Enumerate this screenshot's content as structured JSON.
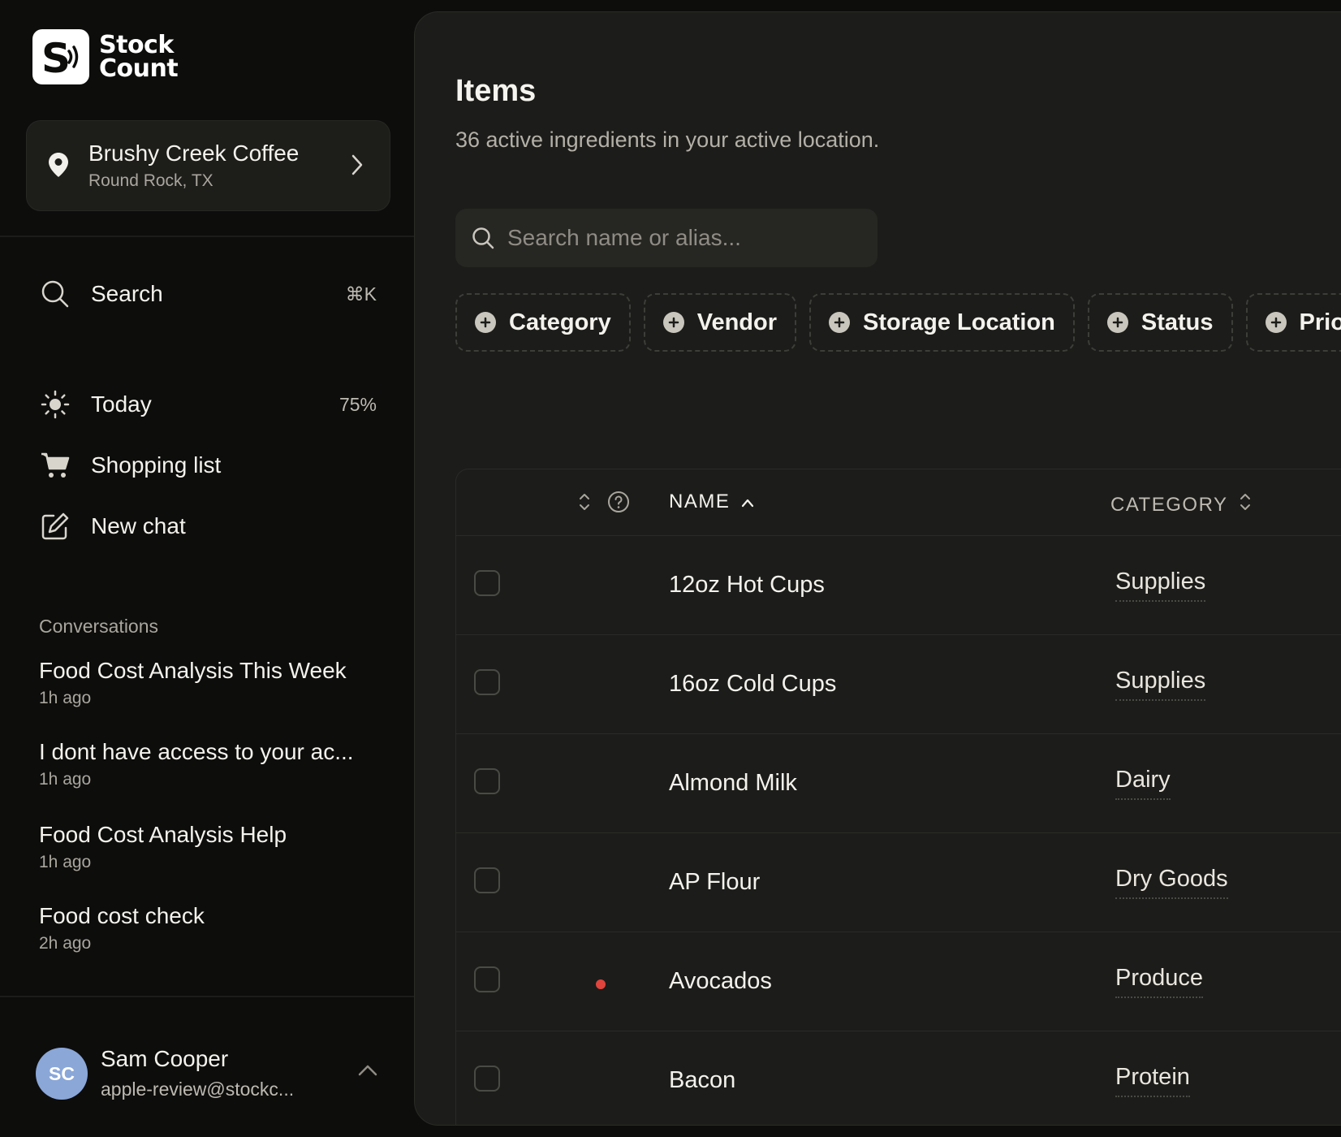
{
  "brand": {
    "line1": "Stock",
    "line2": "Count"
  },
  "location": {
    "name": "Brushy Creek Coffee",
    "city": "Round Rock, TX"
  },
  "nav": {
    "search": {
      "label": "Search",
      "shortcut": "⌘K"
    },
    "today": {
      "label": "Today",
      "progress": "75%"
    },
    "shopping": {
      "label": "Shopping list"
    },
    "new_chat": {
      "label": "New chat"
    }
  },
  "conversations": {
    "heading": "Conversations",
    "items": [
      {
        "title": "Food Cost Analysis This Week",
        "time": "1h ago"
      },
      {
        "title": "I dont have access to your ac...",
        "time": "1h ago"
      },
      {
        "title": "Food Cost Analysis Help",
        "time": "1h ago"
      },
      {
        "title": "Food cost check",
        "time": "2h ago"
      }
    ]
  },
  "user": {
    "initials": "SC",
    "name": "Sam Cooper",
    "email": "apple-review@stockc..."
  },
  "page": {
    "title": "Items",
    "subtitle": "36 active ingredients in your active location.",
    "search_placeholder": "Search name or alias..."
  },
  "filters": [
    "Category",
    "Vendor",
    "Storage Location",
    "Status",
    "Priori"
  ],
  "table": {
    "columns": {
      "name": "NAME",
      "category": "CATEGORY"
    },
    "rows": [
      {
        "name": "12oz Hot Cups",
        "category": "Supplies",
        "alert": false
      },
      {
        "name": "16oz Cold Cups",
        "category": "Supplies",
        "alert": false
      },
      {
        "name": "Almond Milk",
        "category": "Dairy",
        "alert": false
      },
      {
        "name": "AP Flour",
        "category": "Dry Goods",
        "alert": false
      },
      {
        "name": "Avocados",
        "category": "Produce",
        "alert": true
      },
      {
        "name": "Bacon",
        "category": "Protein",
        "alert": false
      }
    ]
  },
  "colors": {
    "accent_alert": "#e0443c",
    "avatar": "#8aa7d8",
    "panel": "#1c1c1a",
    "sidebar": "#0d0d0c"
  }
}
